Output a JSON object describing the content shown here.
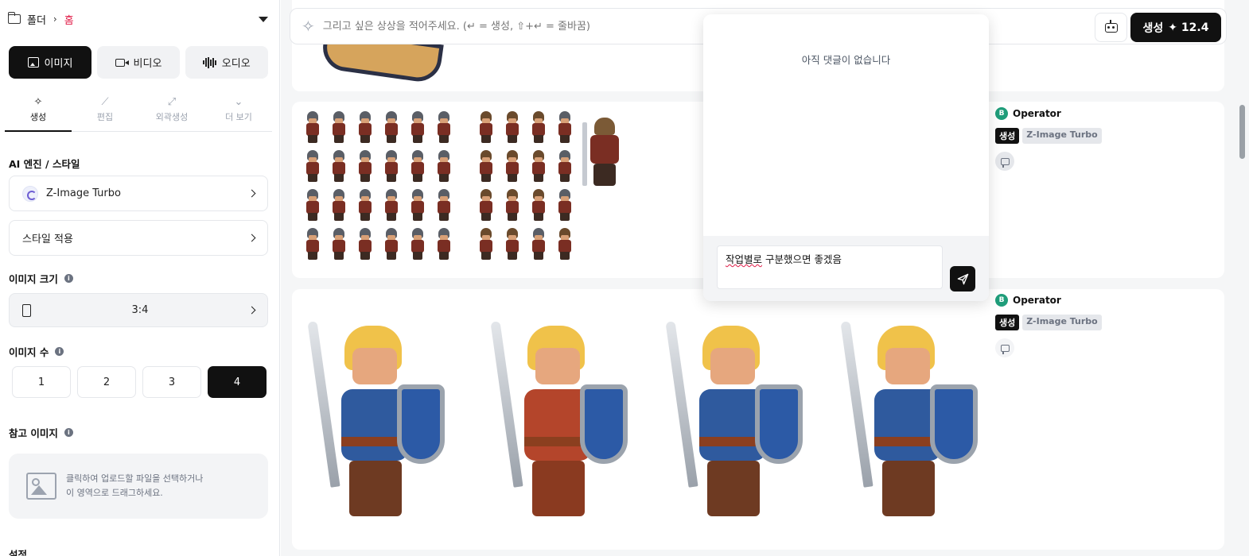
{
  "breadcrumb": {
    "folder": "폴더",
    "home": "홈"
  },
  "media_tabs": [
    "이미지",
    "비디오",
    "오디오"
  ],
  "sub_tabs": [
    {
      "icon": "✧",
      "label": "생성"
    },
    {
      "icon": "⟋",
      "label": "편집"
    },
    {
      "icon": "⤢",
      "label": "외곽생성"
    },
    {
      "icon": "⌄",
      "label": "더 보기"
    }
  ],
  "sections": {
    "engine": "AI 엔진 / 스타일",
    "size": "이미지 크기",
    "count": "이미지 수",
    "reference": "참고 이미지",
    "settings": "설정"
  },
  "engine_value": "Z-Image Turbo",
  "style_label": "스타일 적용",
  "size_value": "3:4",
  "counts": [
    "1",
    "2",
    "3",
    "4"
  ],
  "selected_count": "4",
  "upload_text_1": "클릭하여 업로드할 파일을 선택하거나",
  "upload_text_2": "이 영역으로 드래그하세요.",
  "prompt_placeholder": "그리고 싶은 상상을 적어주세요. (↵ = 생성, ⇧+↵ = 줄바꿈)",
  "generate_button": "생성",
  "credits": "✦ 12.4",
  "popover": {
    "empty": "아직 댓글이 없습니다",
    "comment_text_underlined": "작업별로",
    "comment_text_rest": " 구분했으면 좋겠음"
  },
  "results": [
    {
      "user": "Operator",
      "avatar": "B",
      "tag_mode": "생성",
      "tag_model": "Z-Image Turbo"
    },
    {
      "user": "Operator",
      "avatar": "B",
      "tag_mode": "생성",
      "tag_model": "Z-Image Turbo"
    }
  ]
}
